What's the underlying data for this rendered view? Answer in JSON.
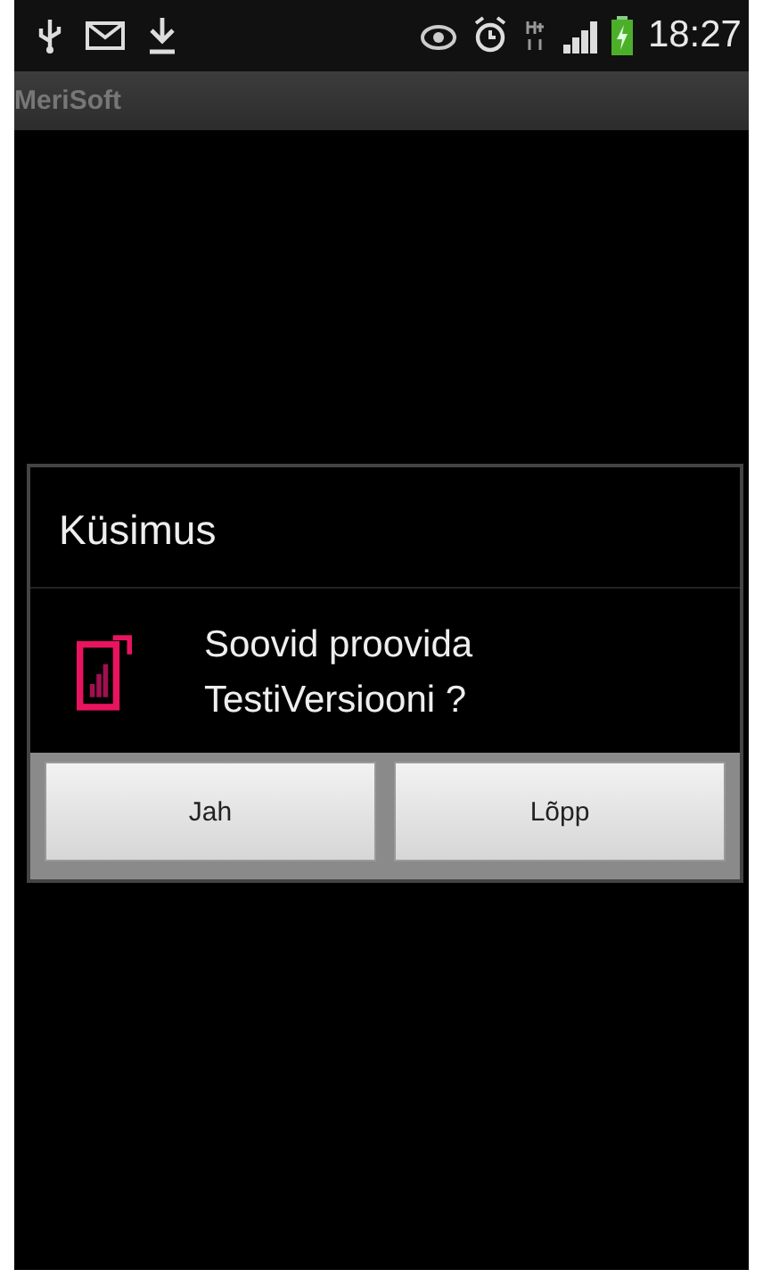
{
  "status_bar": {
    "time": "18:27"
  },
  "app_bar": {
    "title": "MeriSoft"
  },
  "dialog": {
    "title": "Küsimus",
    "message": "Soovid proovida TestiVersiooni ?",
    "buttons": [
      "Jah",
      "Lõpp"
    ]
  }
}
